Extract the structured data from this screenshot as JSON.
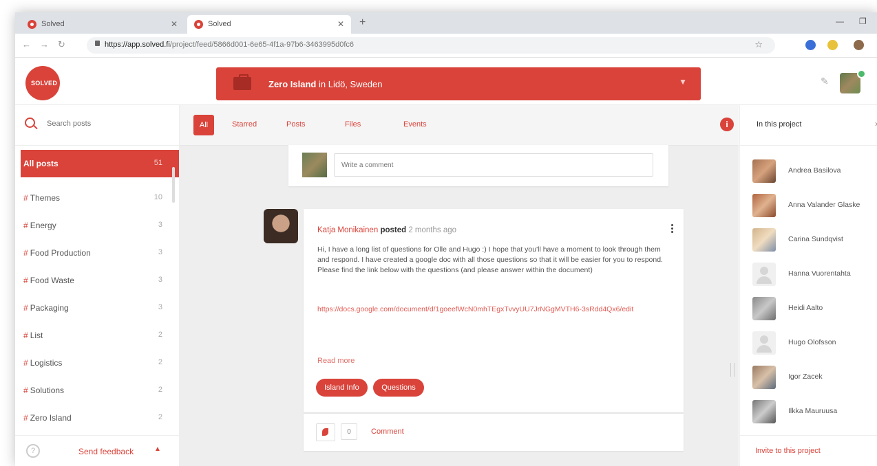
{
  "browser": {
    "tabs": [
      {
        "title": "Solved"
      },
      {
        "title": "Solved"
      }
    ],
    "url_host": "https://app.solved.fi",
    "url_path": "/project/feed/5866d001-6e65-4f1a-97b6-3463995d0fc6"
  },
  "app": {
    "logo_text": "SOLVED",
    "project": {
      "name": "Zero Island",
      "location": "in Lidö, Sweden"
    }
  },
  "sidebar": {
    "search_placeholder": "Search posts",
    "categories": [
      {
        "label": "All posts",
        "count": "51",
        "active": true
      },
      {
        "label": "Themes",
        "count": "10"
      },
      {
        "label": "Energy",
        "count": "3"
      },
      {
        "label": "Food Production",
        "count": "3"
      },
      {
        "label": "Food Waste",
        "count": "3"
      },
      {
        "label": "Packaging",
        "count": "3"
      },
      {
        "label": "List",
        "count": "2"
      },
      {
        "label": "Logistics",
        "count": "2"
      },
      {
        "label": "Solutions",
        "count": "2"
      },
      {
        "label": "Zero Island",
        "count": "2"
      }
    ],
    "feedback_label": "Send feedback"
  },
  "filters": {
    "tabs": [
      "All",
      "Starred",
      "Posts",
      "Files",
      "Events"
    ],
    "info_label": "i"
  },
  "comment_box": {
    "placeholder": "Write a comment"
  },
  "post": {
    "author": "Katja Monikainen",
    "verb": "posted",
    "time": "2 months ago",
    "body": "Hi, I have a long list of questions for Olle and Hugo :) I hope that you'll have a moment to look through them and respond. I have created a google doc with all those questions so that it will be easier for you to respond. Please find the link below with the questions (and please answer within the document)",
    "link": "https://docs.google.com/document/d/1goeefWcN0mhTEgxTvvyUU7JrNGgMVTH6-3sRdd4Qx6/edit",
    "read_more": "Read more",
    "tags": [
      "Island Info",
      "Questions"
    ],
    "like_count": "0",
    "comment_label": "Comment"
  },
  "members_panel": {
    "title": "In this project",
    "close_label": "›",
    "members": [
      {
        "name": "Andrea Basilova"
      },
      {
        "name": "Anna Valander Glaske"
      },
      {
        "name": "Carina Sundqvist"
      },
      {
        "name": "Hanna Vuorentahta"
      },
      {
        "name": "Heidi Aalto"
      },
      {
        "name": "Hugo Olofsson"
      },
      {
        "name": "Igor Zacek"
      },
      {
        "name": "Ilkka Mauruusa"
      }
    ],
    "invite_label": "Invite to this project"
  },
  "colors": {
    "accent": "#d9433a",
    "feed_bg": "#eeeeee"
  },
  "icons": [
    "search-icon",
    "briefcase-icon",
    "chevron-down-icon",
    "info-icon",
    "kebab-menu-icon",
    "like-icon",
    "help-icon",
    "chat-icon"
  ]
}
